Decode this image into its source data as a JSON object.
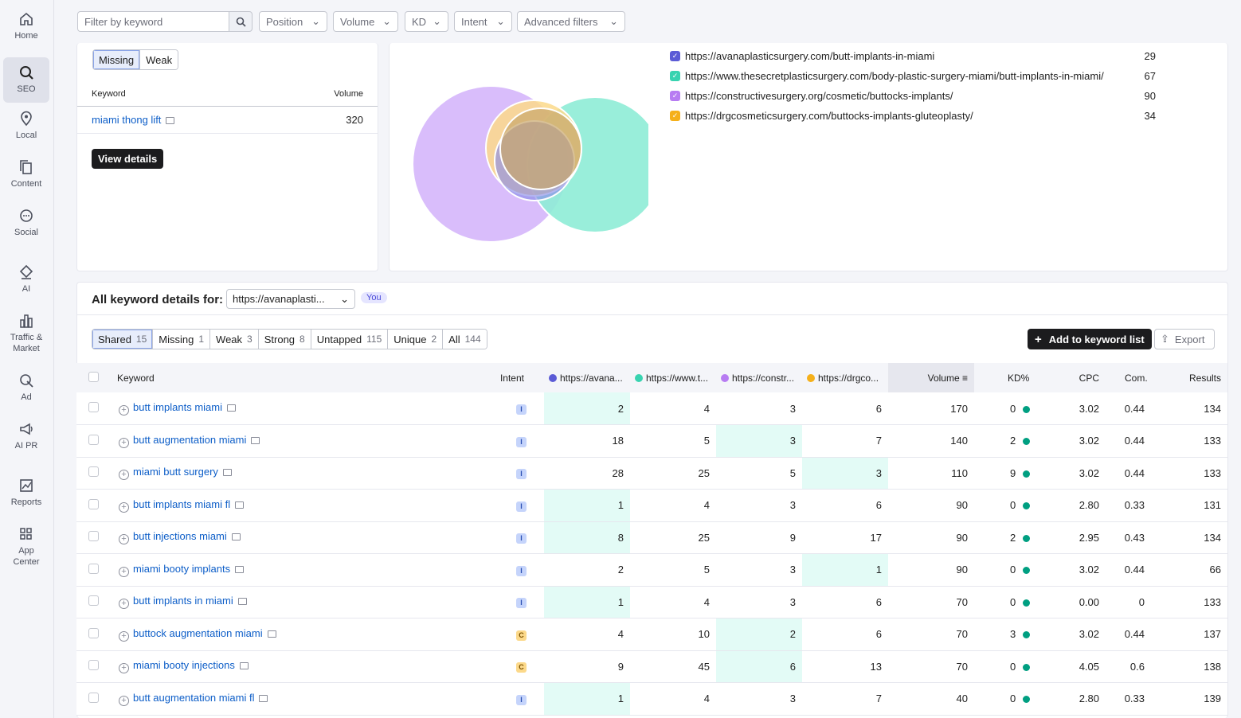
{
  "nav": [
    {
      "label": "Home",
      "icon": "home-icon"
    },
    {
      "label": "SEO",
      "icon": "seo-icon",
      "active": true
    },
    {
      "label": "Local",
      "icon": "location-pin-icon"
    },
    {
      "label": "Content",
      "icon": "content-icon"
    },
    {
      "label": "Social",
      "icon": "social-icon"
    },
    {
      "label": "AI",
      "icon": "ai-icon"
    },
    {
      "label": "Traffic & Market",
      "icon": "bar-chart-icon"
    },
    {
      "label": "Ad",
      "icon": "ad-icon"
    },
    {
      "label": "AI PR",
      "icon": "megaphone-icon"
    },
    {
      "label": "Reports",
      "icon": "reports-icon"
    },
    {
      "label": "App Center",
      "icon": "grid-icon"
    }
  ],
  "filters": {
    "search_placeholder": "Filter by keyword",
    "position": "Position",
    "volume": "Volume",
    "kd": "KD",
    "intent": "Intent",
    "advanced": "Advanced filters"
  },
  "gap_card": {
    "tab_missing": "Missing",
    "tab_weak": "Weak",
    "col_keyword": "Keyword",
    "col_volume": "Volume",
    "row_keyword": "miami thong lift",
    "row_volume": "320",
    "view_details": "View details"
  },
  "venn": {
    "legend": [
      {
        "url": "https://avanaplasticsurgery.com/butt-implants-in-miami",
        "count": "29",
        "color": "#5b5bd6"
      },
      {
        "url": "https://www.thesecretplasticsurgery.com/body-plastic-surgery-miami/butt-implants-in-miami/",
        "count": "67",
        "color": "#38d3b0"
      },
      {
        "url": "https://constructivesurgery.org/cosmetic/buttocks-implants/",
        "count": "90",
        "color": "#b77cf2"
      },
      {
        "url": "https://drgcosmeticsurgery.com/buttocks-implants-gluteoplasty/",
        "count": "34",
        "color": "#f5b01a"
      }
    ]
  },
  "details": {
    "title": "All keyword details for:",
    "domain_select": "https://avanaplasti...",
    "you_badge": "You",
    "tabs": [
      {
        "label": "Shared",
        "count": "15",
        "on": true
      },
      {
        "label": "Missing",
        "count": "1"
      },
      {
        "label": "Weak",
        "count": "3"
      },
      {
        "label": "Strong",
        "count": "8"
      },
      {
        "label": "Untapped",
        "count": "115"
      },
      {
        "label": "Unique",
        "count": "2"
      },
      {
        "label": "All",
        "count": "144"
      }
    ],
    "add_button": "Add to keyword list",
    "export_button": "Export"
  },
  "table": {
    "headers": {
      "keyword": "Keyword",
      "intent": "Intent",
      "d1": "https://avana...",
      "d2": "https://www.t...",
      "d3": "https://constr...",
      "d4": "https://drgco...",
      "volume": "Volume",
      "kd": "KD%",
      "cpc": "CPC",
      "com": "Com.",
      "results": "Results"
    },
    "domain_colors": [
      "#5b5bd6",
      "#38d3b0",
      "#b77cf2",
      "#f5b01a"
    ],
    "rows": [
      {
        "kw": "butt implants miami",
        "intent": "I",
        "p": [
          "2",
          "4",
          "3",
          "6"
        ],
        "best": 0,
        "vol": "170",
        "kd": "0",
        "cpc": "3.02",
        "com": "0.44",
        "res": "134"
      },
      {
        "kw": "butt augmentation miami",
        "intent": "I",
        "p": [
          "18",
          "5",
          "3",
          "7"
        ],
        "best": 2,
        "vol": "140",
        "kd": "2",
        "cpc": "3.02",
        "com": "0.44",
        "res": "133"
      },
      {
        "kw": "miami butt surgery",
        "intent": "I",
        "p": [
          "28",
          "25",
          "5",
          "3"
        ],
        "best": 3,
        "vol": "110",
        "kd": "9",
        "cpc": "3.02",
        "com": "0.44",
        "res": "133"
      },
      {
        "kw": "butt implants miami fl",
        "intent": "I",
        "p": [
          "1",
          "4",
          "3",
          "6"
        ],
        "best": 0,
        "vol": "90",
        "kd": "0",
        "cpc": "2.80",
        "com": "0.33",
        "res": "131"
      },
      {
        "kw": "butt injections miami",
        "intent": "I",
        "p": [
          "8",
          "25",
          "9",
          "17"
        ],
        "best": 0,
        "vol": "90",
        "kd": "2",
        "cpc": "2.95",
        "com": "0.43",
        "res": "134"
      },
      {
        "kw": "miami booty implants",
        "intent": "I",
        "p": [
          "2",
          "5",
          "3",
          "1"
        ],
        "best": 3,
        "vol": "90",
        "kd": "0",
        "cpc": "3.02",
        "com": "0.44",
        "res": "66"
      },
      {
        "kw": "butt implants in miami",
        "intent": "I",
        "p": [
          "1",
          "4",
          "3",
          "6"
        ],
        "best": 0,
        "vol": "70",
        "kd": "0",
        "cpc": "0.00",
        "com": "0",
        "res": "133"
      },
      {
        "kw": "buttock augmentation miami",
        "intent": "C",
        "p": [
          "4",
          "10",
          "2",
          "6"
        ],
        "best": 2,
        "vol": "70",
        "kd": "3",
        "cpc": "3.02",
        "com": "0.44",
        "res": "137"
      },
      {
        "kw": "miami booty injections",
        "intent": "C",
        "p": [
          "9",
          "45",
          "6",
          "13"
        ],
        "best": 2,
        "vol": "70",
        "kd": "0",
        "cpc": "4.05",
        "com": "0.6",
        "res": "138"
      },
      {
        "kw": "butt augmentation miami fl",
        "intent": "I",
        "p": [
          "1",
          "4",
          "3",
          "7"
        ],
        "best": 0,
        "vol": "40",
        "kd": "0",
        "cpc": "2.80",
        "com": "0.33",
        "res": "139"
      }
    ]
  }
}
